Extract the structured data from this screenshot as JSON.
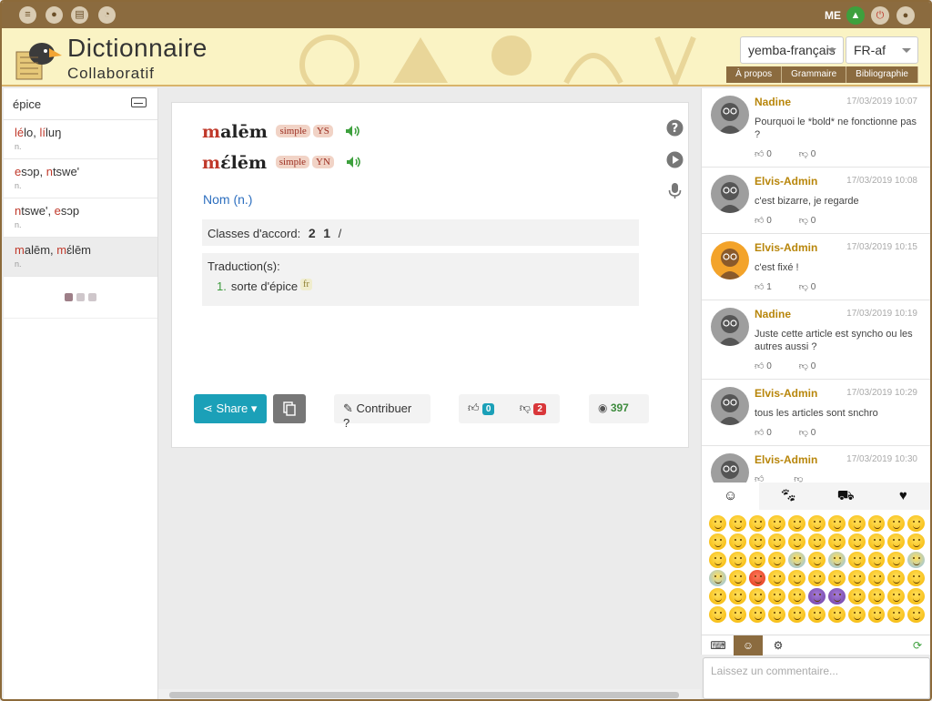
{
  "topbar": {
    "user_label": "ME"
  },
  "header": {
    "title": "Dictionnaire",
    "subtitle": "Collaboratif",
    "language_select": "yemba-français",
    "locale_select": "FR-af",
    "nav": [
      "À propos",
      "Grammaire",
      "Bibliographie"
    ]
  },
  "sidebar": {
    "search_value": "épice",
    "items": [
      {
        "parts": [
          [
            "lé",
            "red"
          ],
          [
            "lo, ",
            ""
          ],
          [
            "lí",
            "red"
          ],
          [
            "luŋ",
            ""
          ]
        ],
        "pos": "n."
      },
      {
        "parts": [
          [
            "e",
            "red"
          ],
          [
            "sɔp, ",
            ""
          ],
          [
            "n",
            "red"
          ],
          [
            "tswe'",
            ""
          ]
        ],
        "pos": "n."
      },
      {
        "parts": [
          [
            "n",
            "red"
          ],
          [
            "tswe', ",
            ""
          ],
          [
            "e",
            "red"
          ],
          [
            "sɔp",
            ""
          ]
        ],
        "pos": "n."
      },
      {
        "parts": [
          [
            "m",
            "red"
          ],
          [
            "alēm, ",
            ""
          ],
          [
            "m",
            "red"
          ],
          [
            "ɛ́lēm",
            ""
          ]
        ],
        "pos": "n."
      }
    ]
  },
  "entry": {
    "forms": [
      {
        "lead": "m",
        "rest": "alēm",
        "tags": [
          "simple",
          "YS"
        ]
      },
      {
        "lead": "m",
        "rest": "ɛ́lēm",
        "tags": [
          "simple",
          "YN"
        ]
      }
    ],
    "pos": "Nom (n.)",
    "classes_label": "Classes d'accord:",
    "classes_values": [
      "2",
      "1",
      "/"
    ],
    "translations_label": "Traduction(s):",
    "translations": [
      {
        "num": "1.",
        "text": "sorte d'épice",
        "lang": "fr"
      }
    ],
    "share_label": "Share",
    "contribute_label": "Contribuer ?",
    "likes": "0",
    "dislikes": "2",
    "views": "397"
  },
  "chat": {
    "messages": [
      {
        "user": "Nadine",
        "date": "17/03/2019 10:07",
        "text": "Pourquoi le *bold* ne fonctionne pas ?",
        "up": "0",
        "down": "0",
        "avatar": "grey"
      },
      {
        "user": "Elvis-Admin",
        "date": "17/03/2019 10:08",
        "text": "c'est bizarre, je regarde",
        "up": "0",
        "down": "0",
        "avatar": "grey"
      },
      {
        "user": "Elvis-Admin",
        "date": "17/03/2019 10:15",
        "text": "c'est fixé !",
        "up": "1",
        "down": "0",
        "avatar": "orange"
      },
      {
        "user": "Nadine",
        "date": "17/03/2019 10:19",
        "text": "Juste cette article est synch​o ou les autres aussi ?",
        "up": "0",
        "down": "0",
        "avatar": "grey"
      },
      {
        "user": "Elvis-Admin",
        "date": "17/03/2019 10:29",
        "text": "tous les articles sont snchro",
        "up": "0",
        "down": "0",
        "avatar": "grey"
      },
      {
        "user": "Elvis-Admin",
        "date": "17/03/2019 10:30",
        "text": "",
        "up": "",
        "down": "",
        "avatar": "grey"
      }
    ],
    "comment_placeholder": "Laissez un commentaire..."
  },
  "colors": {
    "brand": "#8b6b3f",
    "header_bg": "#faf3c4",
    "accent_red": "#c0392b",
    "share": "#1ba0b8"
  }
}
